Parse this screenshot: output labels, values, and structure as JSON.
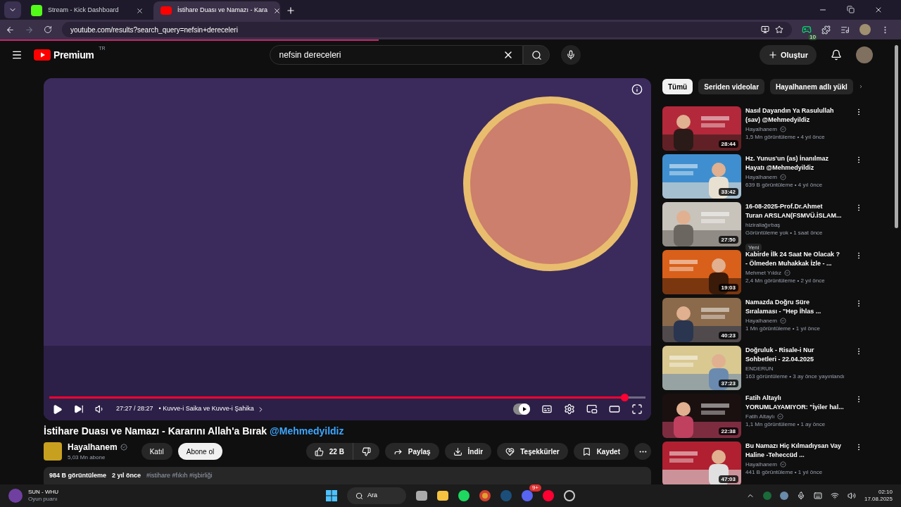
{
  "browser": {
    "tabs": [
      {
        "title": "Stream - Kick Dashboard",
        "selected": false,
        "kind": "kick"
      },
      {
        "title": "İstihare Duası ve Namazı - Kara",
        "selected": true,
        "kind": "youtube"
      }
    ],
    "url": "youtube.com/results?search_query=nefsin+dereceleri",
    "extension_count": "10"
  },
  "header": {
    "logo": "Premium",
    "region": "TR",
    "search": "nefsin dereceleri",
    "create": "Oluştur"
  },
  "player": {
    "time": "27:27 / 28:27",
    "chapter": "• Kuvve-i Saika ve Kuvve-i Şahika",
    "level": 0.965,
    "autoplay": true
  },
  "video": {
    "title": "İstihare Duası ve Namazı - Kararını Allah'a Bırak",
    "handle": "@Mehmedyildiz",
    "channel": "Hayalhanem",
    "verified": true,
    "subscribers": "5,03 Mn abone",
    "join": "Katıl",
    "subscribe": "Abone ol",
    "likes": "22 B",
    "share": "Paylaş",
    "download": "İndir",
    "thanks": "Teşekkürler",
    "save": "Kaydet",
    "views": "984 B görüntüleme",
    "ago": "2 yıl önce",
    "tags": "#istihare #fıkıh #işbirliği"
  },
  "filters": [
    {
      "label": "Tümü",
      "selected": true
    },
    {
      "label": "Seriden videolar",
      "selected": false
    },
    {
      "label": "Hayalhanem adlı yükl",
      "selected": false
    }
  ],
  "recommendations": [
    {
      "title_lines": [
        "Nasıl Dayandın Ya Rasulullah",
        "(sav)  @Mehmedyildiz"
      ],
      "channel": "Hayalhanem",
      "verified": true,
      "meta": "1,5 Mn görüntüleme • 4 yıl önce",
      "duration": "28:44"
    },
    {
      "title_lines": [
        "Hz. Yunus'un (as) İnanılmaz",
        "Hayatı @Mehmedyildiz"
      ],
      "channel": "Hayalhanem",
      "verified": true,
      "meta": "639 B görüntüleme • 4 yıl önce",
      "duration": "33:42"
    },
    {
      "title_lines": [
        "16-08-2025-Prof.Dr.Ahmet",
        "Turan ARSLAN(FSMVÜ.İSLAM..."
      ],
      "channel": "hiziraliağırbaş",
      "verified": false,
      "meta": "Görüntüleme yok • 1 saat önce",
      "duration": "27:50",
      "badge": "Yeni"
    },
    {
      "title_lines": [
        "Kabirde İlk 24 Saat Ne Olacak ?",
        "- Ölmeden Muhakkak İzle - ..."
      ],
      "channel": "Mehmet Yıldız",
      "verified": true,
      "meta": "2,4 Mn görüntüleme • 2 yıl önce",
      "duration": "19:03"
    },
    {
      "title_lines": [
        "Namazda Doğru Süre",
        "Sıralaması - \"Hep İhlas ..."
      ],
      "channel": "Hayalhanem",
      "verified": true,
      "meta": "1 Mn görüntüleme • 1 yıl önce",
      "duration": "40:23"
    },
    {
      "title_lines": [
        "Doğruluk - Risale-i Nur",
        "Sohbetleri - 22.04.2025"
      ],
      "channel": "ENDERUN",
      "verified": false,
      "meta": "163 görüntüleme • 3 ay önce yayınlandı",
      "duration": "37:23"
    },
    {
      "title_lines": [
        "Fatih Altaylı",
        "YORUMLAYAMIYOR: \"İyiler hal..."
      ],
      "channel": "Fatih Altaylı",
      "verified": true,
      "meta": "1,1 Mn görüntüleme • 1 ay önce",
      "duration": "22:38"
    },
    {
      "title_lines": [
        "Bu Namazı Hiç Kılmadıysan Vay",
        "Haline -Teheccüd ..."
      ],
      "channel": "Hayalhanem",
      "verified": true,
      "meta": "441 B görüntüleme • 1 yıl önce",
      "duration": "47:03"
    }
  ],
  "taskbar": {
    "game": "SUN - WHU",
    "game_sub": "Oyun puanı",
    "search": "Ara",
    "time": "02:10",
    "date": "17.08.2025",
    "discord_badge": "9+"
  }
}
